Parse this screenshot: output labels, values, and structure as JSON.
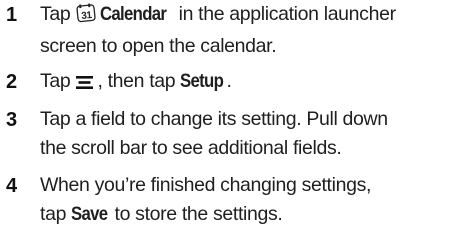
{
  "steps": [
    {
      "number": "1",
      "line1_pre": "Tap ",
      "icon": "calendar-app-icon",
      "keyword": "Calendar",
      "line1_post": " in the application launcher",
      "line2": "screen to open the calendar."
    },
    {
      "number": "2",
      "pre": "Tap ",
      "icon": "menu-icon",
      "mid": ", then tap ",
      "keyword": "Setup",
      "post": "."
    },
    {
      "number": "3",
      "line1": "Tap a field to change its setting. Pull down",
      "line2": "the scroll bar to see additional fields."
    },
    {
      "number": "4",
      "line1": "When you’re finished changing settings,",
      "line2_pre": "tap ",
      "keyword": "Save",
      "line2_post": " to store the settings."
    }
  ]
}
